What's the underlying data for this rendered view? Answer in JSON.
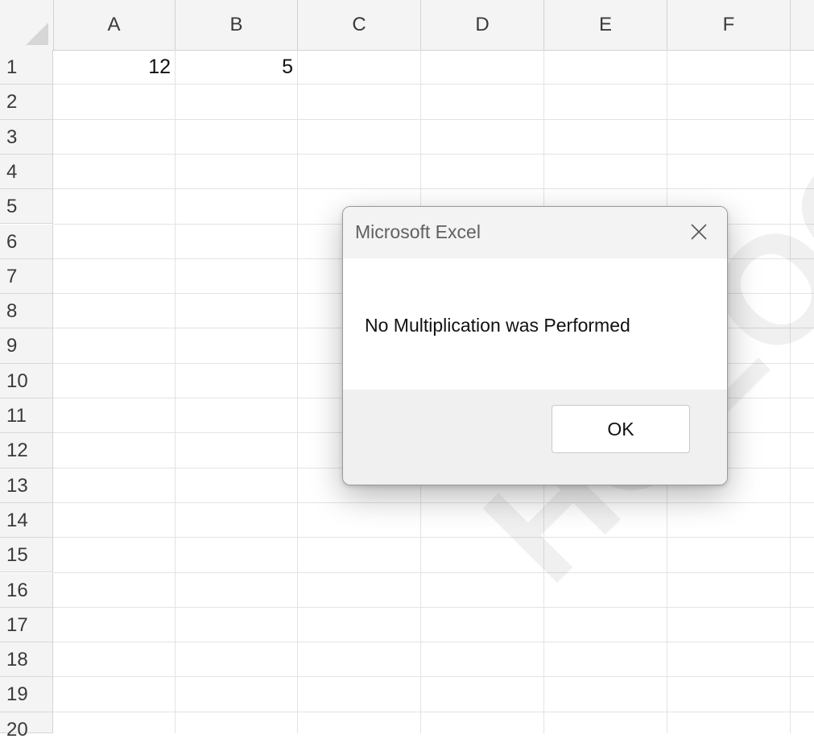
{
  "columns": [
    "A",
    "B",
    "C",
    "D",
    "E",
    "F"
  ],
  "rows": [
    "1",
    "2",
    "3",
    "4",
    "5",
    "6",
    "7",
    "8",
    "9",
    "10",
    "11",
    "12",
    "13",
    "14",
    "15",
    "16",
    "17",
    "18",
    "19",
    "20"
  ],
  "cells": {
    "A1": "12",
    "B1": "5"
  },
  "watermark": "HOLOGY.C",
  "dialog": {
    "title": "Microsoft Excel",
    "message": "No Multiplication was Performed",
    "ok_label": "OK",
    "close_icon": "close-icon"
  }
}
